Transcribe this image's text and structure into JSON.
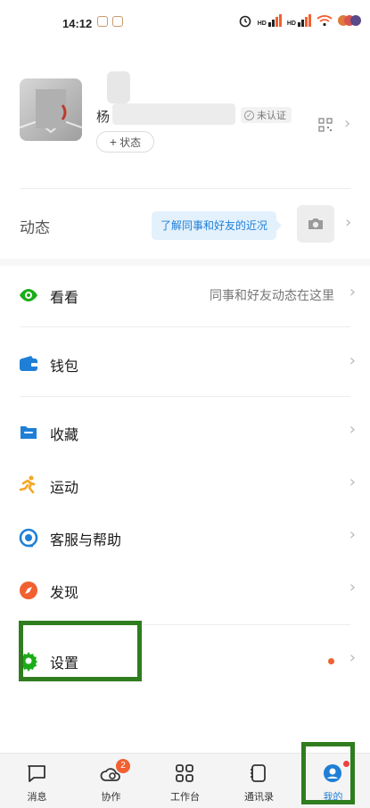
{
  "status_bar": {
    "time": "14:12",
    "signal_1": "HD",
    "signal_2": "HD"
  },
  "profile": {
    "name_initial": "杨",
    "verify_label": "未认证",
    "state_button": "状态"
  },
  "feed": {
    "label": "动态",
    "bubble_text": "了解同事和好友的近况"
  },
  "menu": [
    {
      "label": "看看",
      "hint": "同事和好友动态在这里",
      "icon": "eye-icon",
      "color": "#1aad19"
    },
    {
      "label": "钱包",
      "hint": "",
      "icon": "wallet-icon",
      "color": "#1f7fd6"
    },
    {
      "label": "收藏",
      "hint": "",
      "icon": "folder-icon",
      "color": "#1f7fd6"
    },
    {
      "label": "运动",
      "hint": "",
      "icon": "runner-icon",
      "color": "#f5a623"
    },
    {
      "label": "客服与帮助",
      "hint": "",
      "icon": "headset-icon",
      "color": "#1f7fd6"
    },
    {
      "label": "发现",
      "hint": "",
      "icon": "compass-icon",
      "color": "#f06030"
    },
    {
      "label": "设置",
      "hint": "",
      "icon": "gear-icon",
      "color": "#1aad19"
    }
  ],
  "tabs": [
    {
      "label": "消息",
      "icon": "message-icon",
      "badge": ""
    },
    {
      "label": "协作",
      "icon": "cloud-doc-icon",
      "badge": "2"
    },
    {
      "label": "工作台",
      "icon": "grid-icon",
      "badge": ""
    },
    {
      "label": "通讯录",
      "icon": "contacts-icon",
      "badge": ""
    },
    {
      "label": "我的",
      "icon": "user-icon",
      "badge": ""
    }
  ],
  "colors": {
    "accent": "#1f7fd6",
    "highlight": "#2f7d1e",
    "alert": "#f06030"
  }
}
